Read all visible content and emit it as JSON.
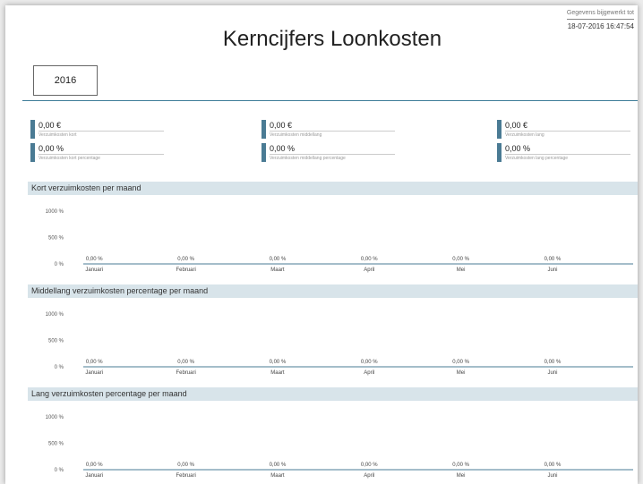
{
  "header": {
    "refresh_label": "Gegevens bijgewerkt tot",
    "refresh_value": "18-07-2016 16:47:54",
    "title": "Kerncijfers Loonkosten",
    "year": "2016"
  },
  "kpis": [
    {
      "value": "0,00 €",
      "label": "Verzuimkosten kort"
    },
    {
      "value": "0,00 %",
      "label": "Verzuimkosten kort percentage"
    },
    {
      "value": "0,00 €",
      "label": "Verzuimkosten middellang"
    },
    {
      "value": "0,00 %",
      "label": "Verzuimkosten middellang percentage"
    },
    {
      "value": "0,00 €",
      "label": "Verzuimkosten lang"
    },
    {
      "value": "0,00 %",
      "label": "Verzuimkosten lang percentage"
    }
  ],
  "sections": {
    "short_title": "Kort verzuimkosten per maand",
    "medium_title": "Middellang verzuimkosten percentage per maand",
    "long_title": "Lang verzuimkosten percentage per maand"
  },
  "chart_data": [
    {
      "type": "bar",
      "title": "Kort verzuimkosten per maand",
      "categories": [
        "Januari",
        "Februari",
        "Maart",
        "April",
        "Mei",
        "Juni"
      ],
      "values": [
        0,
        0,
        0,
        0,
        0,
        0
      ],
      "data_labels": [
        "0,00 %",
        "0,00 %",
        "0,00 %",
        "0,00 %",
        "0,00 %",
        "0,00 %"
      ],
      "y_ticks": [
        "1000 %",
        "500 %",
        "0 %"
      ],
      "ylim": [
        0,
        1000
      ],
      "grid": false,
      "bar_color": "#4a7b94"
    },
    {
      "type": "bar",
      "title": "Middellang verzuimkosten percentage per maand",
      "categories": [
        "Januari",
        "Februari",
        "Maart",
        "April",
        "Mei",
        "Juni"
      ],
      "values": [
        0,
        0,
        0,
        0,
        0,
        0
      ],
      "data_labels": [
        "0,00 %",
        "0,00 %",
        "0,00 %",
        "0,00 %",
        "0,00 %",
        "0,00 %"
      ],
      "y_ticks": [
        "1000 %",
        "500 %",
        "0 %"
      ],
      "ylim": [
        0,
        1000
      ],
      "grid": false,
      "bar_color": "#4a7b94"
    },
    {
      "type": "bar",
      "title": "Lang verzuimkosten percentage per maand",
      "categories": [
        "Januari",
        "Februari",
        "Maart",
        "April",
        "Mei",
        "Juni"
      ],
      "values": [
        0,
        0,
        0,
        0,
        0,
        0
      ],
      "data_labels": [
        "0,00 %",
        "0,00 %",
        "0,00 %",
        "0,00 %",
        "0,00 %",
        "0,00 %"
      ],
      "y_ticks": [
        "1000 %",
        "500 %",
        "0 %"
      ],
      "ylim": [
        0,
        1000
      ],
      "grid": false,
      "bar_color": "#4a7b94"
    }
  ]
}
